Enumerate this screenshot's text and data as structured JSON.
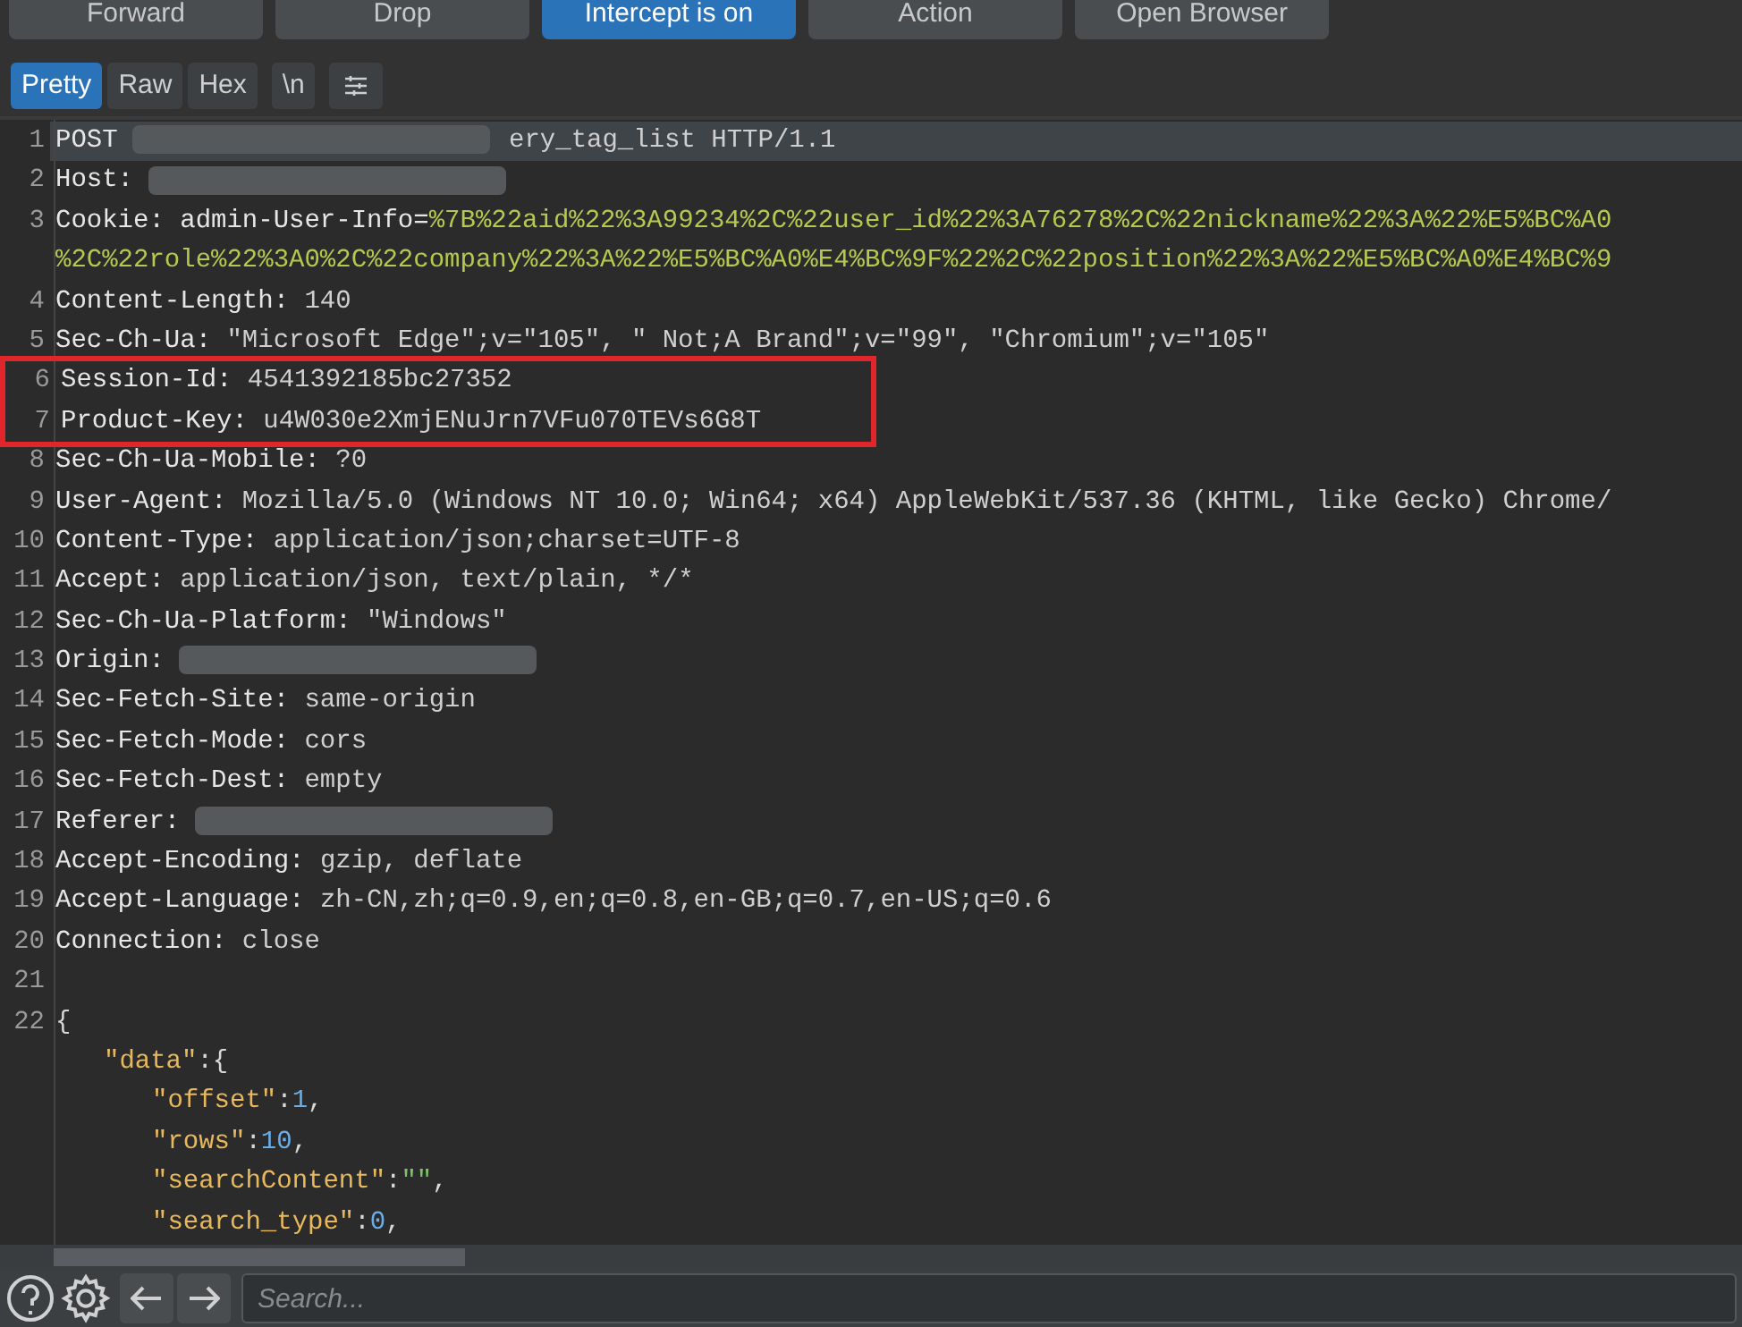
{
  "toolbar": {
    "buttons": [
      {
        "label": "Forward",
        "selected": false
      },
      {
        "label": "Drop",
        "selected": false
      },
      {
        "label": "Intercept is on",
        "selected": true
      },
      {
        "label": "Action",
        "selected": false
      },
      {
        "label": "Open Browser",
        "selected": false
      }
    ]
  },
  "view_tabs": [
    {
      "kind": "text",
      "label": "Pretty",
      "selected": true
    },
    {
      "kind": "text",
      "label": "Raw",
      "selected": false
    },
    {
      "kind": "text",
      "label": "Hex",
      "selected": false
    },
    {
      "kind": "text",
      "label": "\\n",
      "selected": false
    },
    {
      "kind": "icon",
      "selected": false
    }
  ],
  "editor": {
    "lines": [
      {
        "number": "1",
        "selected": true,
        "segments": [
          {
            "kind": "name",
            "text": "POST"
          },
          {
            "kind": "redacted"
          },
          {
            "kind": "value",
            "text": "ery_tag_list HTTP/1.1"
          }
        ]
      },
      {
        "number": "2",
        "selected": false,
        "segments": [
          {
            "kind": "name",
            "text": "Host:"
          },
          {
            "kind": "redacted"
          }
        ]
      },
      {
        "number": "3",
        "selected": false,
        "segments": [
          {
            "kind": "name",
            "text": "Cookie: admin-User-Info="
          },
          {
            "kind": "cookie",
            "text": "%7B%22aid%22%3A99234%2C%22user_id%22%3A76278%2C%22nickname%22%3A%22%E5%BC%A0"
          }
        ]
      },
      {
        "selected": false,
        "segments": [
          {
            "kind": "cookie",
            "text": "%2C%22role%22%3A0%2C%22company%22%3A%22%E5%BC%A0%E4%BC%9F%22%2C%22position%22%3A%22%E5%BC%A0%E4%BC%9"
          }
        ]
      },
      {
        "number": "4",
        "selected": false,
        "segments": [
          {
            "kind": "name",
            "text": "Content-Length:"
          },
          {
            "kind": "value",
            "text": "140"
          }
        ]
      },
      {
        "number": "5",
        "selected": false,
        "segments": [
          {
            "kind": "name",
            "text": "Sec-Ch-Ua:"
          },
          {
            "kind": "value",
            "text": "\"Microsoft Edge\";v=\"105\", \" Not;A Brand\";v=\"99\", \"Chromium\";v=\"105\""
          }
        ]
      },
      {
        "kind": "box",
        "lines": [
          {
            "number": "6",
            "selected": false,
            "segments": [
              {
                "kind": "name",
                "text": "Session-Id:"
              },
              {
                "kind": "value",
                "text": "4541392185bc27352"
              }
            ]
          },
          {
            "number": "7",
            "selected": false,
            "segments": [
              {
                "kind": "name",
                "text": "Product-Key:"
              },
              {
                "kind": "value",
                "text": "u4W030e2XmjENuJrn7VFu070TEVs6G8T"
              }
            ]
          }
        ]
      },
      {
        "number": "8",
        "selected": false,
        "segments": [
          {
            "kind": "name",
            "text": "Sec-Ch-Ua-Mobile:"
          },
          {
            "kind": "value",
            "text": "?0"
          }
        ]
      },
      {
        "number": "9",
        "selected": false,
        "segments": [
          {
            "kind": "name",
            "text": "User-Agent:"
          },
          {
            "kind": "value",
            "text": "Mozilla/5.0 (Windows NT 10.0; Win64; x64) AppleWebKit/537.36 (KHTML, like Gecko) Chrome/"
          }
        ]
      },
      {
        "number": "10",
        "selected": false,
        "segments": [
          {
            "kind": "name",
            "text": "Content-Type:"
          },
          {
            "kind": "value",
            "text": "application/json;charset=UTF-8"
          }
        ]
      },
      {
        "number": "11",
        "selected": false,
        "segments": [
          {
            "kind": "name",
            "text": "Accept:"
          },
          {
            "kind": "value",
            "text": "application/json, text/plain, */*"
          }
        ]
      },
      {
        "number": "12",
        "selected": false,
        "segments": [
          {
            "kind": "name",
            "text": "Sec-Ch-Ua-Platform:"
          },
          {
            "kind": "value",
            "text": "\"Windows\""
          }
        ]
      },
      {
        "number": "13",
        "selected": false,
        "segments": [
          {
            "kind": "name",
            "text": "Origin:"
          },
          {
            "kind": "redacted"
          }
        ]
      },
      {
        "number": "14",
        "selected": false,
        "segments": [
          {
            "kind": "name",
            "text": "Sec-Fetch-Site:"
          },
          {
            "kind": "value",
            "text": "same-origin"
          }
        ]
      },
      {
        "number": "15",
        "selected": false,
        "segments": [
          {
            "kind": "name",
            "text": "Sec-Fetch-Mode:"
          },
          {
            "kind": "value",
            "text": "cors"
          }
        ]
      },
      {
        "number": "16",
        "selected": false,
        "segments": [
          {
            "kind": "name",
            "text": "Sec-Fetch-Dest:"
          },
          {
            "kind": "value",
            "text": "empty"
          }
        ]
      },
      {
        "number": "17",
        "selected": false,
        "segments": [
          {
            "kind": "name",
            "text": "Referer:"
          },
          {
            "kind": "redacted"
          }
        ]
      },
      {
        "number": "18",
        "selected": false,
        "segments": [
          {
            "kind": "name",
            "text": "Accept-Encoding:"
          },
          {
            "kind": "value",
            "text": "gzip, deflate"
          }
        ]
      },
      {
        "number": "19",
        "selected": false,
        "segments": [
          {
            "kind": "name",
            "text": "Accept-Language:"
          },
          {
            "kind": "value",
            "text": "zh-CN,zh;q=0.9,en;q=0.8,en-GB;q=0.7,en-US;q=0.6"
          }
        ]
      },
      {
        "number": "20",
        "selected": false,
        "segments": [
          {
            "kind": "name",
            "text": "Connection:"
          },
          {
            "kind": "value",
            "text": "close"
          }
        ]
      },
      {
        "number": "21",
        "selected": false
      },
      {
        "number": "22",
        "selected": false,
        "segments": [
          {
            "kind": "punct",
            "text": "{"
          }
        ],
        "children": [
          {
            "selected": false,
            "segments": [
              {
                "kind": "key",
                "text": "\"data\""
              },
              {
                "kind": "punct",
                "text": ":{"
              }
            ],
            "children": [
              {
                "selected": false,
                "segments": [
                  {
                    "kind": "key",
                    "text": "\"offset\""
                  },
                  {
                    "kind": "punct",
                    "text": ":"
                  },
                  {
                    "kind": "number",
                    "text": "1"
                  },
                  {
                    "kind": "punct",
                    "text": ","
                  }
                ]
              },
              {
                "selected": false,
                "segments": [
                  {
                    "kind": "key",
                    "text": "\"rows\""
                  },
                  {
                    "kind": "punct",
                    "text": ":"
                  },
                  {
                    "kind": "number",
                    "text": "10"
                  },
                  {
                    "kind": "punct",
                    "text": ","
                  }
                ]
              },
              {
                "selected": false,
                "segments": [
                  {
                    "kind": "key",
                    "text": "\"searchContent\""
                  },
                  {
                    "kind": "punct",
                    "text": ":"
                  },
                  {
                    "kind": "string",
                    "text": "\"\""
                  },
                  {
                    "kind": "punct",
                    "text": ","
                  }
                ]
              },
              {
                "selected": false,
                "segments": [
                  {
                    "kind": "key",
                    "text": "\"search_type\""
                  },
                  {
                    "kind": "punct",
                    "text": ":"
                  },
                  {
                    "kind": "number",
                    "text": "0"
                  },
                  {
                    "kind": "punct",
                    "text": ","
                  }
                ]
              }
            ]
          }
        ]
      }
    ]
  },
  "search": {
    "placeholder": "Search..."
  }
}
